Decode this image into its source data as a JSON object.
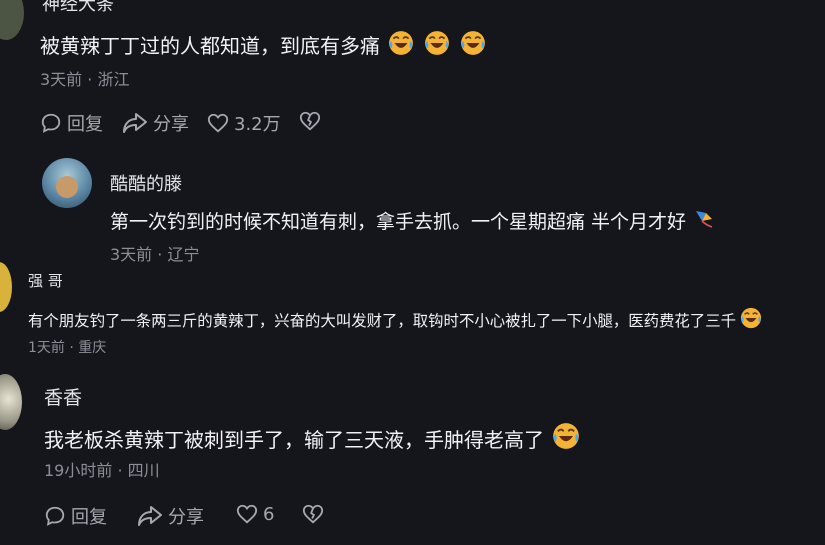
{
  "comments": [
    {
      "name": "神经大条",
      "text": "被黄辣丁丁过的人都知道，到底有多痛",
      "meta": "3天前 · 浙江",
      "actions": {
        "reply": "回复",
        "share": "分享",
        "likes": "3.2万"
      }
    },
    {
      "name": "酷酷的滕",
      "text": "第一次钓到的时候不知道有刺，拿手去抓。一个星期超痛   半个月才好",
      "meta": "3天前 · 辽宁"
    },
    {
      "name": "强 哥",
      "text": "有个朋友钓了一条两三斤的黄辣丁，兴奋的大叫发财了，取钩时不小心被扎了一下小腿，医药费花了三千",
      "meta": "1天前 · 重庆"
    },
    {
      "name": "香香",
      "text": "我老板杀黄辣丁被刺到手了，输了三天液，手肿得老高了",
      "meta": "19小时前 · 四川",
      "actions": {
        "reply": "回复",
        "share": "分享",
        "likes": "6"
      }
    }
  ],
  "icons": {
    "reply": "comment-bubble-icon",
    "share": "share-arrow-icon",
    "like": "heart-icon",
    "dislike": "broken-heart-icon",
    "emoji": "laughing-crying-emoji-icon"
  },
  "colors": {
    "background": "#15151c",
    "meta": "#8d8d97",
    "action": "#a7a7b0",
    "emoji": "#f5b335"
  }
}
